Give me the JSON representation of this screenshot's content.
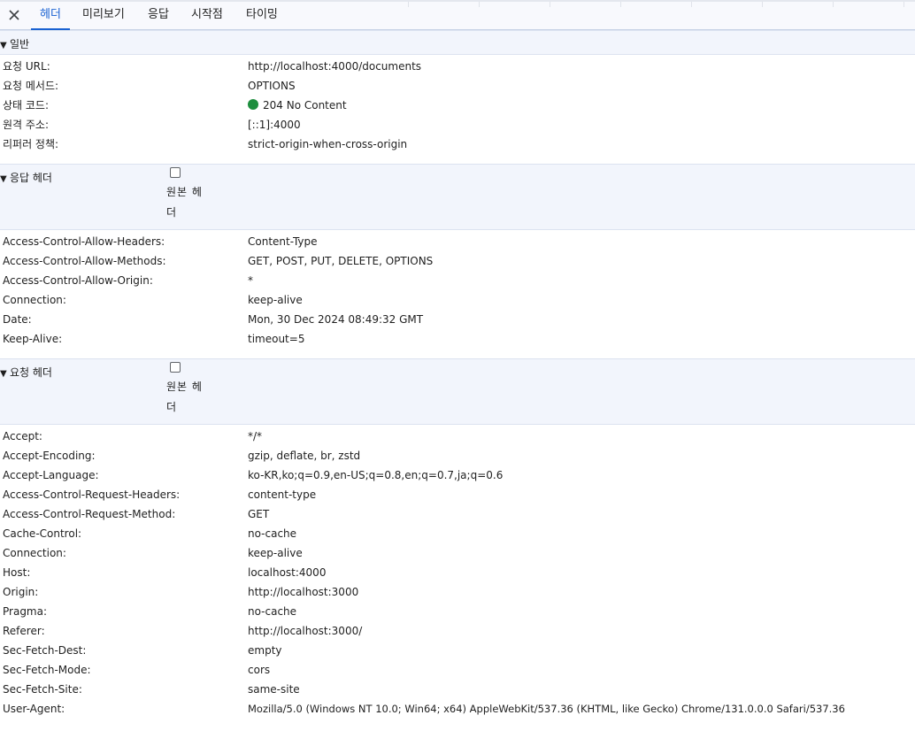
{
  "tabs": [
    {
      "label": "헤더",
      "active": true
    },
    {
      "label": "미리보기"
    },
    {
      "label": "응답"
    },
    {
      "label": "시작점"
    },
    {
      "label": "타이밍"
    }
  ],
  "general": {
    "title": "일반",
    "rows": [
      {
        "key": "요청 URL:",
        "value": "http://localhost:4000/documents"
      },
      {
        "key": "요청 메서드:",
        "value": "OPTIONS"
      },
      {
        "key": "상태 코드:",
        "value": "204 No Content",
        "status_color": "#1e8e3e"
      },
      {
        "key": "원격 주소:",
        "value": "[::1]:4000"
      },
      {
        "key": "리퍼러 정책:",
        "value": "strict-origin-when-cross-origin"
      }
    ]
  },
  "response_headers": {
    "title": "응답 헤더",
    "raw_label": "원본 헤더",
    "rows": [
      {
        "key": "Access-Control-Allow-Headers:",
        "value": "Content-Type"
      },
      {
        "key": "Access-Control-Allow-Methods:",
        "value": "GET, POST, PUT, DELETE, OPTIONS"
      },
      {
        "key": "Access-Control-Allow-Origin:",
        "value": "*"
      },
      {
        "key": "Connection:",
        "value": "keep-alive"
      },
      {
        "key": "Date:",
        "value": "Mon, 30 Dec 2024 08:49:32 GMT"
      },
      {
        "key": "Keep-Alive:",
        "value": "timeout=5"
      }
    ]
  },
  "request_headers": {
    "title": "요청 헤더",
    "raw_label": "원본 헤더",
    "rows": [
      {
        "key": "Accept:",
        "value": "*/*"
      },
      {
        "key": "Accept-Encoding:",
        "value": "gzip, deflate, br, zstd"
      },
      {
        "key": "Accept-Language:",
        "value": "ko-KR,ko;q=0.9,en-US;q=0.8,en;q=0.7,ja;q=0.6"
      },
      {
        "key": "Access-Control-Request-Headers:",
        "value": "content-type"
      },
      {
        "key": "Access-Control-Request-Method:",
        "value": "GET"
      },
      {
        "key": "Cache-Control:",
        "value": "no-cache"
      },
      {
        "key": "Connection:",
        "value": "keep-alive"
      },
      {
        "key": "Host:",
        "value": "localhost:4000"
      },
      {
        "key": "Origin:",
        "value": "http://localhost:3000"
      },
      {
        "key": "Pragma:",
        "value": "no-cache"
      },
      {
        "key": "Referer:",
        "value": "http://localhost:3000/"
      },
      {
        "key": "Sec-Fetch-Dest:",
        "value": "empty"
      },
      {
        "key": "Sec-Fetch-Mode:",
        "value": "cors"
      },
      {
        "key": "Sec-Fetch-Site:",
        "value": "same-site"
      },
      {
        "key": "User-Agent:",
        "value": "Mozilla/5.0 (Windows NT 10.0; Win64; x64) AppleWebKit/537.36 (KHTML, like Gecko) Chrome/131.0.0.0 Safari/537.36"
      }
    ]
  },
  "accent_color": "#1a62d2"
}
